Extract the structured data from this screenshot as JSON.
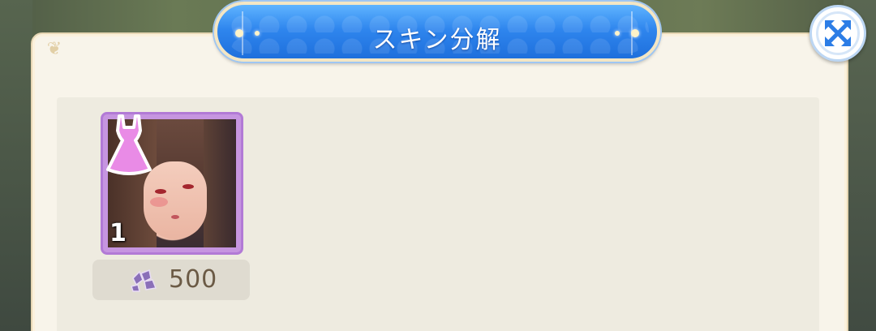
{
  "dialog": {
    "title": "スキン分解"
  },
  "close_button": {
    "icon": "close-icon"
  },
  "items": [
    {
      "type_icon": "dress-icon",
      "portrait": "character-portrait",
      "count": "1",
      "rarity_color": "#c695e0",
      "cost_icon": "shard-icon",
      "cost_value": "500"
    }
  ],
  "colors": {
    "banner_blue": "#2f86ee",
    "panel_bg": "#f8f4ea",
    "cost_text": "#6b5a45"
  }
}
